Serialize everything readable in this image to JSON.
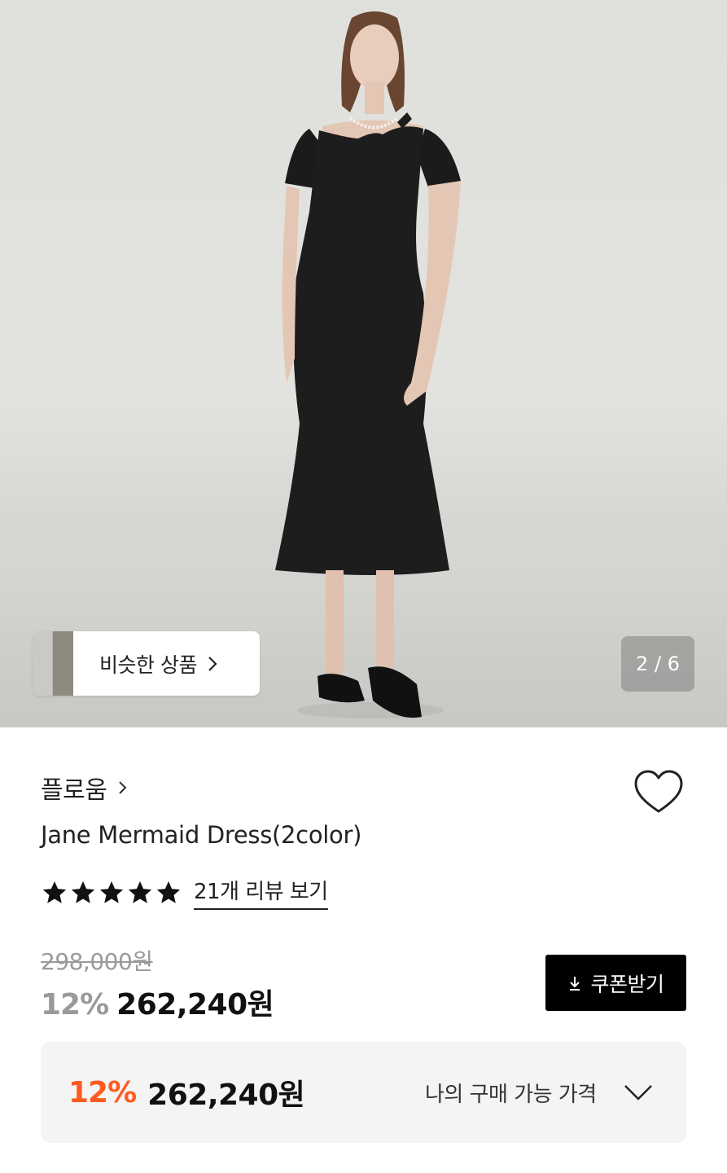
{
  "gallery": {
    "similar_label": "비슷한 상품",
    "counter": "2 / 6"
  },
  "product": {
    "brand": "플로움",
    "title": "Jane Mermaid Dress(2color)",
    "rating_stars": 5,
    "review_link": "21개 리뷰 보기",
    "original_price": "298,000원",
    "discount_pct": "12%",
    "sale_price": "262,240원"
  },
  "coupon": {
    "label": "쿠폰받기",
    "icon": "download-icon"
  },
  "my_price": {
    "discount_pct": "12%",
    "amount": "262,240원",
    "label": "나의 구매 가능 가격",
    "icon": "chevron-down-icon"
  },
  "colors": {
    "accent_orange": "#ff5a1f",
    "coupon_bg": "#000000",
    "muted_text": "#9a9a9a"
  }
}
